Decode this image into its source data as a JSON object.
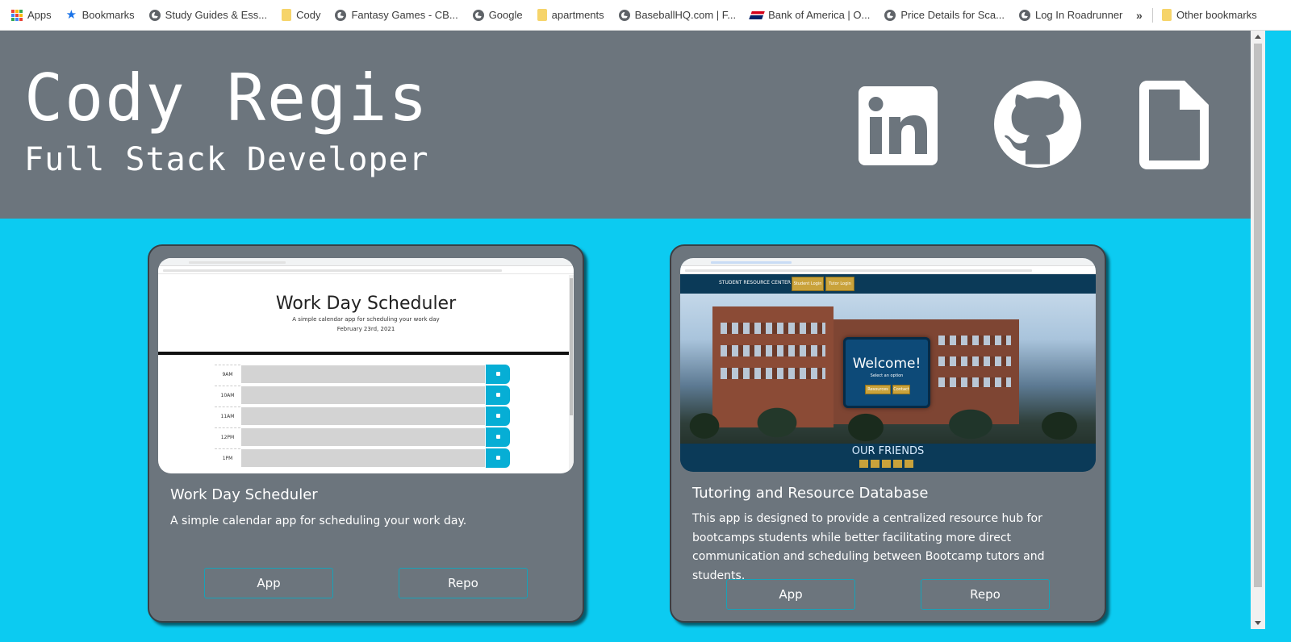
{
  "bookmarks_bar": {
    "items": [
      {
        "label": "Apps",
        "icon": "apps-grid-icon"
      },
      {
        "label": "Bookmarks",
        "icon": "star-icon"
      },
      {
        "label": "Study Guides & Ess...",
        "icon": "globe-icon"
      },
      {
        "label": "Cody",
        "icon": "folder-icon"
      },
      {
        "label": "Fantasy Games - CB...",
        "icon": "globe-icon"
      },
      {
        "label": "Google",
        "icon": "globe-icon"
      },
      {
        "label": "apartments",
        "icon": "folder-icon"
      },
      {
        "label": "BaseballHQ.com | F...",
        "icon": "globe-icon"
      },
      {
        "label": "Bank of America | O...",
        "icon": "bank-of-america-icon"
      },
      {
        "label": "Price Details for Sca...",
        "icon": "globe-icon"
      },
      {
        "label": "Log In Roadrunner",
        "icon": "globe-icon"
      }
    ],
    "more": "»",
    "other_bookmarks": "Other bookmarks"
  },
  "header": {
    "name": "Cody Regis",
    "role": "Full Stack Developer",
    "icons": [
      "linkedin-icon",
      "github-icon",
      "resume-document-icon"
    ]
  },
  "projects": [
    {
      "title": "Work Day Scheduler",
      "description": "A simple calendar app for scheduling your work day.",
      "app_label": "App",
      "repo_label": "Repo",
      "preview": {
        "heading": "Work Day Scheduler",
        "subheading": "A simple calendar app for scheduling your work day",
        "date": "February 23rd, 2021",
        "hours": [
          "9AM",
          "10AM",
          "11AM",
          "12PM",
          "1PM"
        ]
      }
    },
    {
      "title": "Tutoring and Resource Database",
      "description": "This app is designed to provide a centralized resource hub for bootcamps students while better facilitating more direct communication and scheduling between Bootcamp tutors and students.",
      "app_label": "App",
      "repo_label": "Repo",
      "preview": {
        "nav_title": "STUDENT RESOURCE CENTER",
        "nav_buttons": [
          "Student Login",
          "Tutor Login"
        ],
        "welcome": "Welcome!",
        "welcome_sub": "Select an option",
        "welcome_buttons": [
          "Resources",
          "Contact"
        ],
        "friends": "OUR FRIENDS"
      }
    }
  ],
  "colors": {
    "header_bg": "#6c757d",
    "page_bg": "#0ccbf1",
    "button_border": "#17a2b8"
  }
}
